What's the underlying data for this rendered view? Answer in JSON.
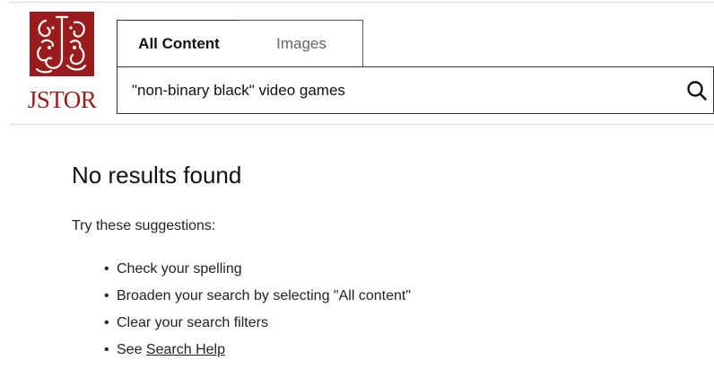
{
  "logo": {
    "wordmark": "JSTOR",
    "mark_color": "#9b1c1c"
  },
  "tabs": [
    {
      "label": "All Content",
      "active": true
    },
    {
      "label": "Images",
      "active": false
    }
  ],
  "search": {
    "value": "\"non-binary black\" video games",
    "icon": "search-icon"
  },
  "main": {
    "title": "No results found",
    "intro": "Try these suggestions:",
    "suggestions": [
      "Check your spelling",
      "Broaden your search by selecting \"All content\"",
      "Clear your search filters"
    ],
    "help": {
      "prefix": "See ",
      "link_label": "Search Help"
    }
  }
}
